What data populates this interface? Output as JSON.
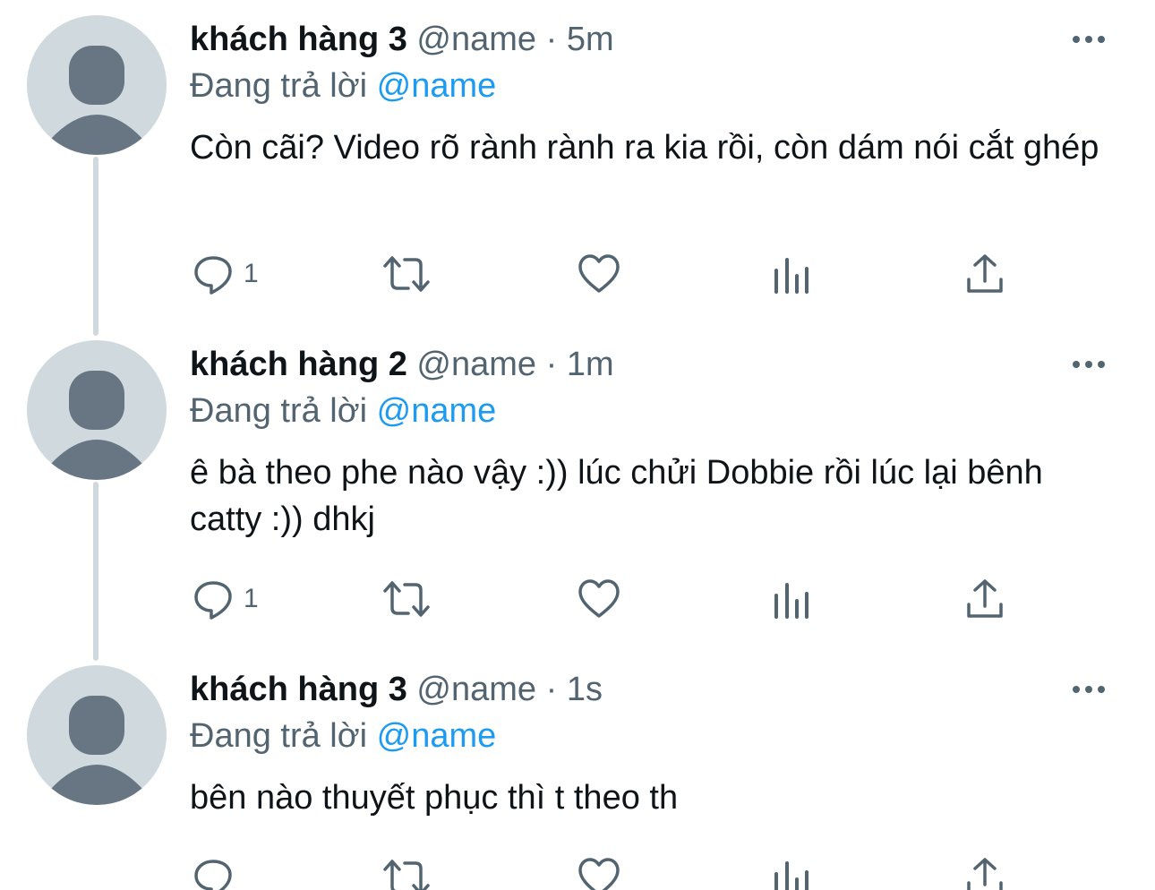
{
  "tweets": [
    {
      "display_name": "khách hàng 3",
      "handle": "@name",
      "separator": "·",
      "time": "5m",
      "replying_prefix": "Đang trả lời",
      "replying_to": "@name",
      "text": "Còn cãi? Video rõ rành rành ra kia rồi, còn dám nói cắt ghép",
      "reply_count": "1"
    },
    {
      "display_name": "khách hàng 2",
      "handle": "@name",
      "separator": "·",
      "time": "1m",
      "replying_prefix": "Đang trả lời",
      "replying_to": "@name",
      "text": "ê bà theo phe nào vậy :)) lúc chửi Dobbie rồi lúc lại bênh catty :)) dhkj",
      "reply_count": "1"
    },
    {
      "display_name": "khách hàng 3",
      "handle": "@name",
      "separator": "·",
      "time": "1s",
      "replying_prefix": "Đang trả lời",
      "replying_to": "@name",
      "text": "bên nào thuyết phục thì t theo th",
      "reply_count": ""
    }
  ],
  "icons": {
    "avatar": "default-avatar-icon",
    "more": "more-dots-icon",
    "reply": "reply-bubble-icon",
    "retweet": "retweet-icon",
    "like": "heart-icon",
    "views": "analytics-bars-icon",
    "share": "share-icon"
  },
  "colors": {
    "text_primary": "#0f1419",
    "text_secondary": "#536471",
    "link": "#1d9bf0",
    "avatar_bg": "#cfd9de",
    "avatar_figure": "#687684",
    "thread_line": "#cfd9de"
  }
}
